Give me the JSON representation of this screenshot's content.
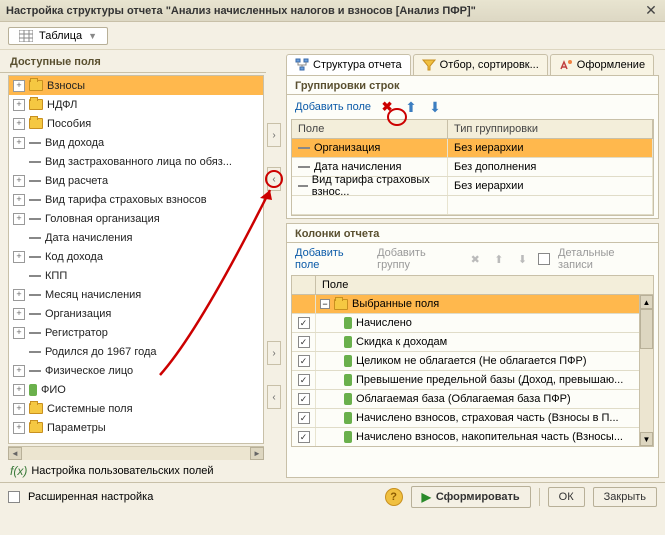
{
  "title": "Настройка структуры отчета \"Анализ начисленных налогов и взносов [Анализ ПФР]\"",
  "toolbar": {
    "view_mode": "Таблица"
  },
  "left": {
    "title": "Доступные поля",
    "user_fields": "Настройка пользовательских полей",
    "tree": [
      {
        "label": "Взносы",
        "icon": "folder",
        "expand": "+",
        "selected": true
      },
      {
        "label": "НДФЛ",
        "icon": "folder",
        "expand": "+"
      },
      {
        "label": "Пособия",
        "icon": "folder",
        "expand": "+"
      },
      {
        "label": "Вид дохода",
        "icon": "dash",
        "expand": "+"
      },
      {
        "label": "Вид застрахованного лица по обяз...",
        "icon": "dash",
        "expand": ""
      },
      {
        "label": "Вид расчета",
        "icon": "dash",
        "expand": "+"
      },
      {
        "label": "Вид тарифа страховых взносов",
        "icon": "dash",
        "expand": "+"
      },
      {
        "label": "Головная организация",
        "icon": "dash",
        "expand": "+"
      },
      {
        "label": "Дата начисления",
        "icon": "dash",
        "expand": ""
      },
      {
        "label": "Код дохода",
        "icon": "dash",
        "expand": "+"
      },
      {
        "label": "КПП",
        "icon": "dash",
        "expand": ""
      },
      {
        "label": "Месяц начисления",
        "icon": "dash",
        "expand": "+"
      },
      {
        "label": "Организация",
        "icon": "dash",
        "expand": "+"
      },
      {
        "label": "Регистратор",
        "icon": "dash",
        "expand": "+"
      },
      {
        "label": "Родился до 1967 года",
        "icon": "dash",
        "expand": ""
      },
      {
        "label": "Физическое лицо",
        "icon": "dash",
        "expand": "+"
      },
      {
        "label": "ФИО",
        "icon": "green",
        "expand": "+"
      },
      {
        "label": "Системные поля",
        "icon": "folder",
        "expand": "+"
      },
      {
        "label": "Параметры",
        "icon": "folder",
        "expand": "+"
      }
    ]
  },
  "tabs": [
    {
      "label": "Структура отчета",
      "active": true
    },
    {
      "label": "Отбор, сортировк...",
      "active": false
    },
    {
      "label": "Оформление",
      "active": false
    }
  ],
  "groups": {
    "title": "Группировки строк",
    "add_field": "Добавить поле",
    "headers": {
      "field": "Поле",
      "type": "Тип группировки"
    },
    "rows": [
      {
        "field": "Организация",
        "type": "Без иерархии",
        "selected": true
      },
      {
        "field": "Дата начисления",
        "type": "Без дополнения"
      },
      {
        "field": "Вид тарифа страховых взнос...",
        "type": "Без иерархии"
      }
    ]
  },
  "columns": {
    "title": "Колонки отчета",
    "add_field": "Добавить поле",
    "add_group": "Добавить группу",
    "detailed": "Детальные записи",
    "header": "Поле",
    "root": "Выбранные поля",
    "rows": [
      {
        "label": "Начислено"
      },
      {
        "label": "Скидка к доходам"
      },
      {
        "label": "Целиком не облагается (Не облагается ПФР)"
      },
      {
        "label": "Превышение предельной базы (Доход, превышаю..."
      },
      {
        "label": "Облагаемая база (Облагаемая база ПФР)"
      },
      {
        "label": "Начислено взносов, страховая часть (Взносы в П..."
      },
      {
        "label": "Начислено взносов, накопительная часть (Взносы..."
      }
    ]
  },
  "footer": {
    "extended": "Расширенная настройка",
    "generate": "Сформировать",
    "ok": "ОК",
    "close": "Закрыть"
  }
}
